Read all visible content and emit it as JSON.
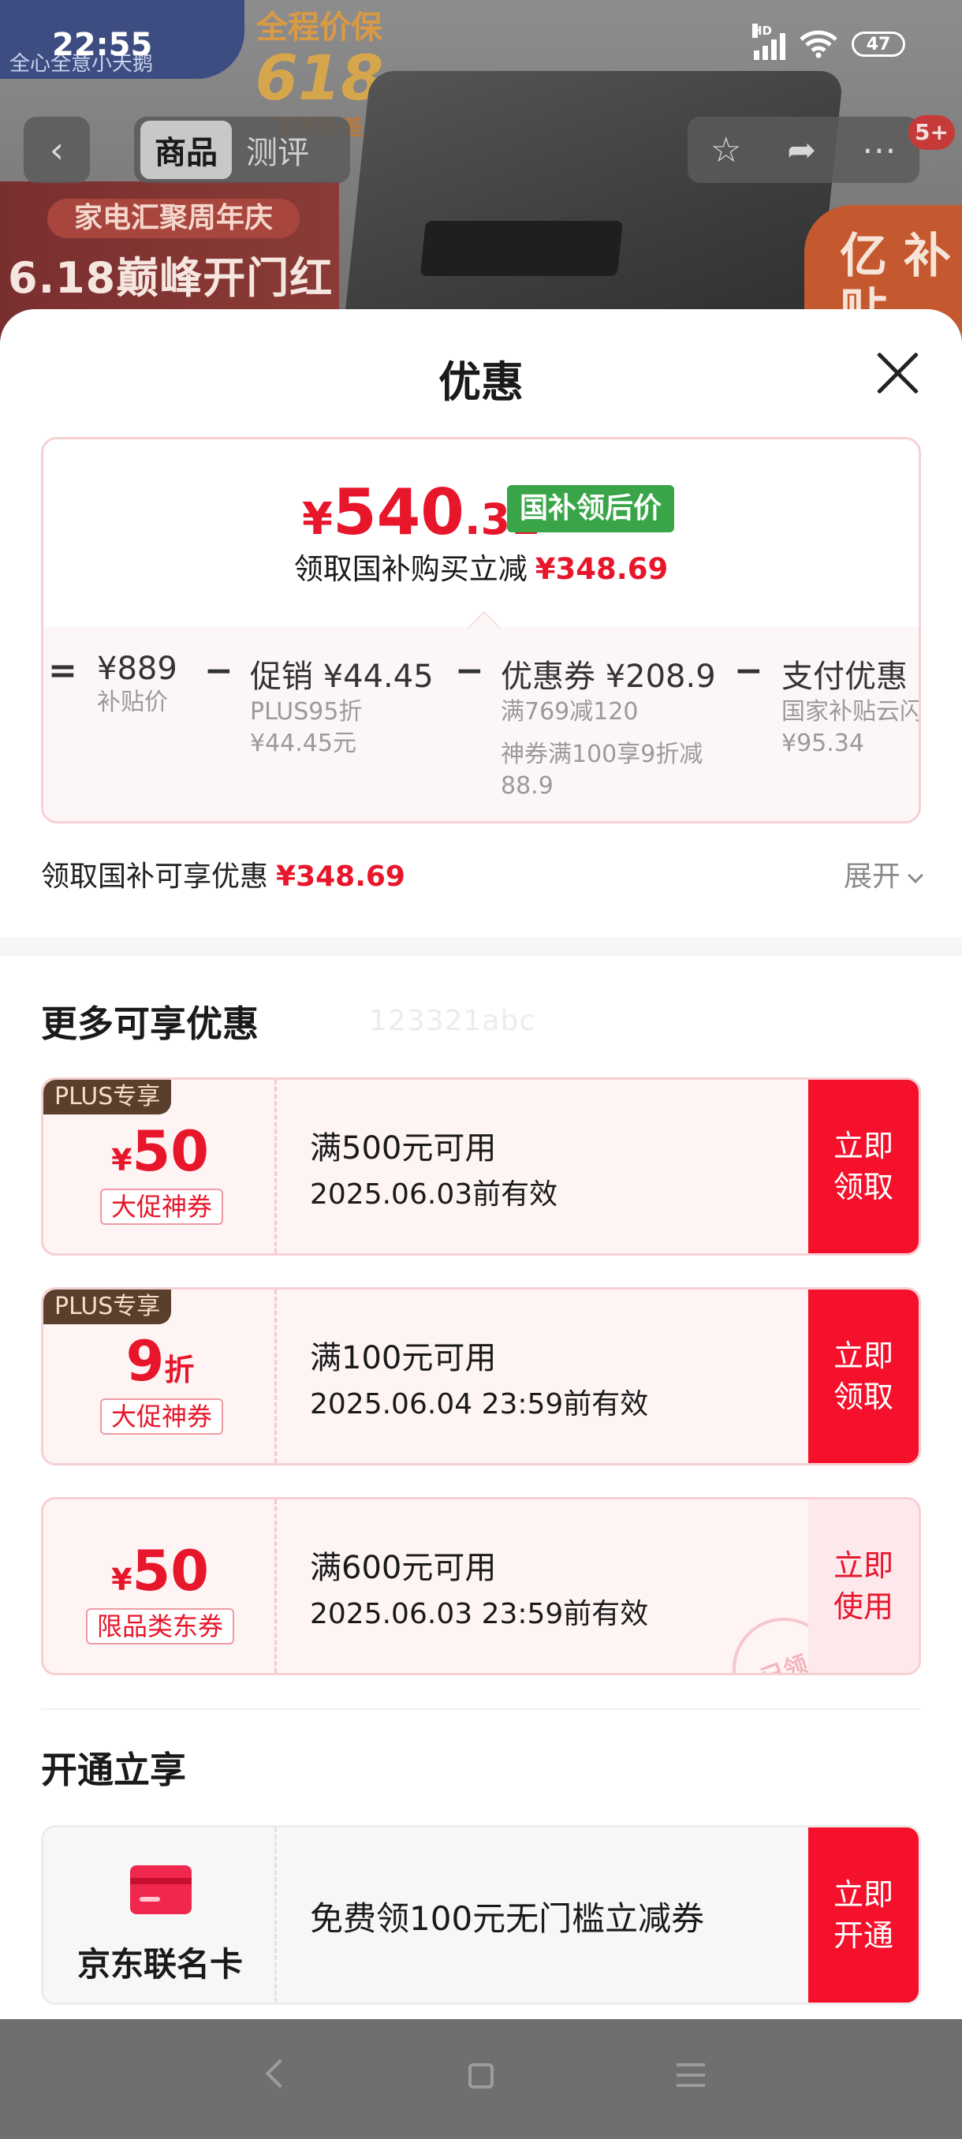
{
  "status": {
    "time": "22:55",
    "battery": "47",
    "hd": "HD"
  },
  "background": {
    "banner_line1": "家电汇聚周年庆",
    "banner_line2": "6.18巅峰开门红",
    "promo_a": "全程价保",
    "promo_b": "618",
    "promo_c": "买贵补差",
    "subsidy": "亿 补贴",
    "brand_sub": "全心全意小天鹅"
  },
  "nav": {
    "tabs": [
      {
        "label": "商品"
      },
      {
        "label": "测评"
      }
    ],
    "badge": "5+"
  },
  "sheet": {
    "title": "优惠",
    "price": {
      "yen": "¥",
      "int": "540",
      "dec": ".31",
      "tag": "国补领后价",
      "reduce_text": "领取国补购买立减",
      "reduce_value": "¥348.69"
    },
    "breakdown": [
      {
        "op": "=",
        "head": "¥889",
        "sub1": "补贴价",
        "sub2": "",
        "sub3": ""
      },
      {
        "op": "−",
        "head": "促销 ¥44.45",
        "sub1": "PLUS95折",
        "sub2": "¥44.45元",
        "sub3": ""
      },
      {
        "op": "−",
        "head": "优惠券 ¥208.9",
        "sub1": "满769减120",
        "sub2": "神券满100享9折减",
        "sub3": "88.9"
      },
      {
        "op": "−",
        "head": "支付优惠 ¥",
        "sub1": "国家补贴云闪",
        "sub2": "¥95.34",
        "sub3": ""
      }
    ],
    "enjoy": {
      "label": "领取国补可享优惠",
      "value": "¥348.69",
      "expand": "展开"
    },
    "more_title": "更多可享优惠",
    "watermark": "123321abc",
    "coupons": [
      {
        "plus": "PLUS专享",
        "prefix": "¥",
        "amount": "50",
        "suffix": "",
        "tag": "大促神券",
        "cond": "满500元可用",
        "expire": "2025.06.03前有效",
        "btn": "立即\n领取"
      },
      {
        "plus": "PLUS专享",
        "prefix": "",
        "amount": "9",
        "suffix": "折",
        "tag": "大促神券",
        "cond": "满100元可用",
        "expire": "2025.06.04 23:59前有效",
        "btn": "立即\n领取"
      },
      {
        "plus": "",
        "prefix": "¥",
        "amount": "50",
        "suffix": "",
        "tag": "限品类东券",
        "cond": "满600元可用",
        "expire": "2025.06.03 23:59前有效",
        "btn": "立即\n使用",
        "stamp": "已领"
      }
    ],
    "open_title": "开通立享",
    "card": {
      "name": "京东联名卡",
      "desc": "免费领100元无门槛立减券",
      "btn": "立即\n开通"
    }
  },
  "colors": {
    "accent": "#e8162b",
    "green_tag": "#3aa548",
    "btn_red": "#f5112b"
  }
}
